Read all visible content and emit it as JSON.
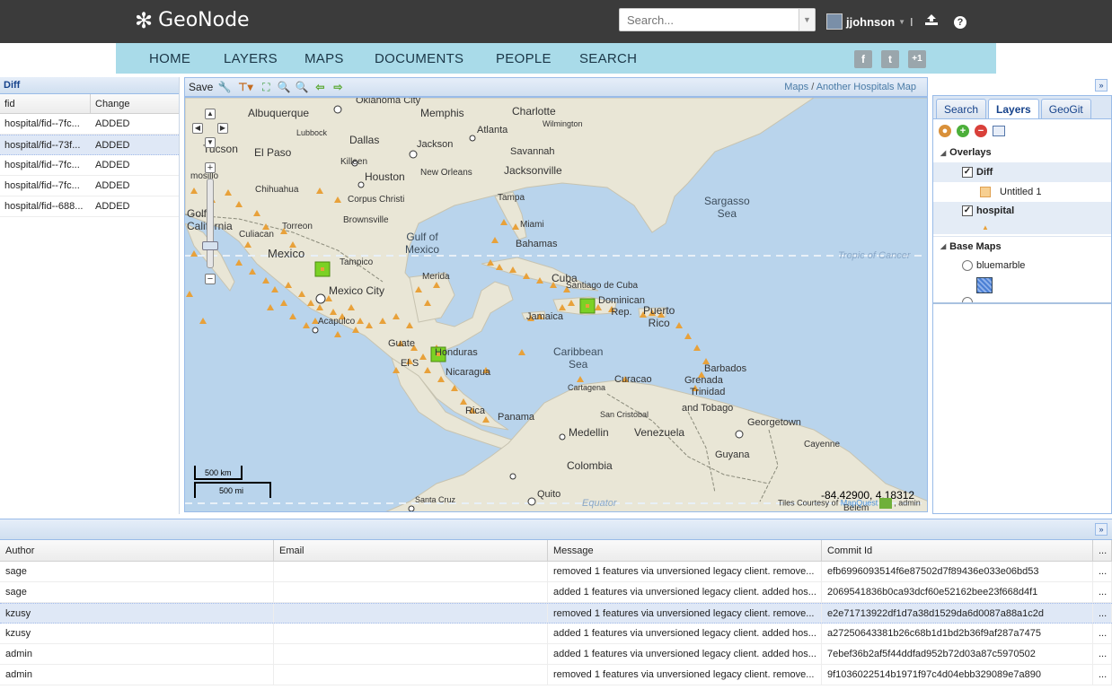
{
  "header": {
    "logo_text": "GeoNode",
    "search_placeholder": "Search...",
    "username": "jjohnson",
    "separator": "I",
    "help": "?"
  },
  "nav": {
    "items": [
      "HOME",
      "LAYERS",
      "MAPS",
      "DOCUMENTS",
      "PEOPLE",
      "SEARCH"
    ],
    "social": [
      "f",
      "t",
      "+1"
    ]
  },
  "diff_panel": {
    "title": "Diff",
    "columns": [
      "fid",
      "Change"
    ],
    "rows": [
      {
        "fid": "hospital/fid--7fc...",
        "change": "ADDED"
      },
      {
        "fid": "hospital/fid--73f...",
        "change": "ADDED"
      },
      {
        "fid": "hospital/fid--7fc...",
        "change": "ADDED"
      },
      {
        "fid": "hospital/fid--7fc...",
        "change": "ADDED"
      },
      {
        "fid": "hospital/fid--688...",
        "change": "ADDED"
      }
    ]
  },
  "map_toolbar": {
    "save_label": "Save",
    "crumb_maps": "Maps",
    "crumb_sep": "/",
    "crumb_map": "Another Hospitals Map"
  },
  "map": {
    "labels": {
      "oklahoma": "Oklahoma City",
      "albuquerque": "Albuquerque",
      "memphis": "Memphis",
      "charlotte": "Charlotte",
      "wilmington": "Wilmington",
      "lubbock": "Lubbock",
      "atlanta": "Atlanta",
      "dallas": "Dallas",
      "jackson": "Jackson",
      "tucson": "Tucson",
      "elpaso": "El Paso",
      "savannah": "Savannah",
      "killeen": "Killeen",
      "houston": "Houston",
      "neworleans": "New Orleans",
      "jacksonville": "Jacksonville",
      "chihuahua": "Chihuahua",
      "corpus": "Corpus Christi",
      "tampa": "Tampa",
      "sargasso": "Sargasso\nSea",
      "golfo": "Golfo\nCalifornia",
      "brownsville": "Brownsville",
      "torreon": "Torreon",
      "culiacan": "Culiacan",
      "miami": "Miami",
      "gulf": "Gulf of\nMexico",
      "bahamas": "Bahamas",
      "mexico": "Mexico",
      "tampico": "Tampico",
      "tropic": "Tropic of Cancer",
      "merida": "Merida",
      "cuba": "Cuba",
      "santiago": "Santiago de Cuba",
      "mexicocity": "Mexico City",
      "dominican": "Dominican\nRep.",
      "puerto": "Puerto\nRico",
      "jamaica": "Jamaica",
      "acapulco": "Acapulco",
      "guate": "Guate",
      "honduras": "Honduras",
      "caribbean": "Caribbean\nSea",
      "barbados": "Barbados",
      "elsal": "El S",
      "nicaragua": "Nicaragua",
      "curacao": "Curacao",
      "grenada": "Grenada",
      "trinidad": "Trinidad\nand Tobago",
      "rica": "Rica",
      "cartagena": "Cartagena",
      "panama": "Panama",
      "sancristobal": "San Cristobal",
      "georgetown": "Georgetown",
      "medellin": "Medellin",
      "venezuela": "Venezuela",
      "cayenne": "Cayenne",
      "colombia": "Colombia",
      "guyana": "Guyana",
      "santacruz": "Santa Cruz",
      "quito": "Quito",
      "equator": "Equator",
      "belem": "Belem",
      "hermosillo": "mosillo"
    },
    "scale_km": "500 km",
    "scale_mi": "500 mi",
    "coords": "-84.42900, 4.18312",
    "attribution_prefix": "Tiles Courtesy of",
    "attribution_link": "MapQuest",
    "attribution_suffix": ", admin"
  },
  "right_panel": {
    "tabs": [
      "Search",
      "Layers",
      "GeoGit"
    ],
    "active_tab": "Layers",
    "overlays_title": "Overlays",
    "diff_layer": "Diff",
    "untitled": "Untitled 1",
    "hospital_layer": "hospital",
    "basemaps_title": "Base Maps",
    "bluemarble": "bluemarble"
  },
  "history": {
    "columns": [
      "Author",
      "Email",
      "Message",
      "Commit Id",
      "..."
    ],
    "rows": [
      {
        "author": "sage",
        "email": "",
        "message": "removed 1 features via unversioned legacy client. remove...",
        "commit": "efb6996093514f6e87502d7f89436e033e06bd53",
        "more": "..."
      },
      {
        "author": "sage",
        "email": "",
        "message": "added 1 features via unversioned legacy client. added hos...",
        "commit": "2069541836b0ca93dcf60e52162bee23f668d4f1",
        "more": "..."
      },
      {
        "author": "kzusy",
        "email": "",
        "message": "removed 1 features via unversioned legacy client. remove...",
        "commit": "e2e71713922df1d7a38d1529da6d0087a88a1c2d",
        "more": "..."
      },
      {
        "author": "kzusy",
        "email": "",
        "message": "added 1 features via unversioned legacy client. added hos...",
        "commit": "a27250643381b26c68b1d1bd2b36f9af287a7475",
        "more": "..."
      },
      {
        "author": "admin",
        "email": "",
        "message": "added 1 features via unversioned legacy client. added hos...",
        "commit": "7ebef36b2af5f44ddfad952b72d03a87c5970502",
        "more": "..."
      },
      {
        "author": "admin",
        "email": "",
        "message": "removed 1 features via unversioned legacy client. remove...",
        "commit": "9f1036022514b1971f97c4d04ebb329089e7a890",
        "more": "..."
      }
    ]
  },
  "colors": {
    "header_bg": "#3b3b3b",
    "nav_bg": "#a9dbe9",
    "hospital_marker": "#e8a13a",
    "diff_marker": "#7bd125",
    "ocean": "#b9d4ec",
    "land": "#e9e6d6"
  }
}
